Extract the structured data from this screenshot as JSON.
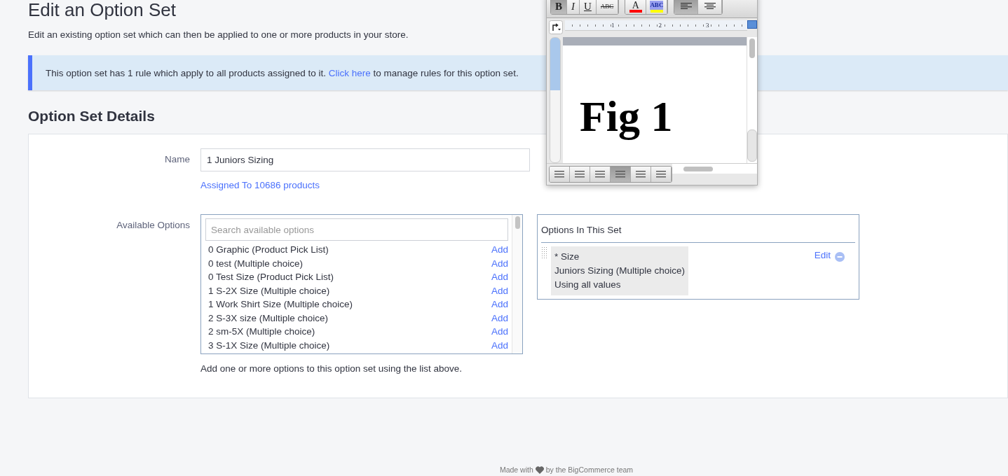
{
  "page": {
    "title": "Edit an Option Set",
    "subtitle": "Edit an existing option set which can then be applied to one or more products in your store."
  },
  "alert": {
    "before": "This option set has 1 rule which apply to all products assigned to it. ",
    "link": "Click here",
    "after": " to manage rules for this option set."
  },
  "section_title": "Option Set Details",
  "name_field": {
    "label": "Name",
    "value": "1 Juniors Sizing",
    "assigned_link": "Assigned To 10686 products"
  },
  "available": {
    "label": "Available Options",
    "placeholder": "Search available options",
    "hint": "Add one or more options to this option set using the list above.",
    "items": [
      {
        "name": "0 Graphic (Product Pick List)",
        "action": "Add"
      },
      {
        "name": "0 test (Multiple choice)",
        "action": "Add"
      },
      {
        "name": "0 Test Size (Product Pick List)",
        "action": "Add"
      },
      {
        "name": "1 S-2X Size (Multiple choice)",
        "action": "Add"
      },
      {
        "name": "1 Work Shirt Size (Multiple choice)",
        "action": "Add"
      },
      {
        "name": "2 S-3X size (Multiple choice)",
        "action": "Add"
      },
      {
        "name": "2 sm-5X (Multiple choice)",
        "action": "Add"
      },
      {
        "name": "3 S-1X Size (Multiple choice)",
        "action": "Add"
      }
    ]
  },
  "in_set": {
    "title": "Options In This Set",
    "items": [
      {
        "lines": [
          "* Size",
          "Juniors Sizing (Multiple choice)",
          "Using all values"
        ],
        "action": "Edit"
      }
    ]
  },
  "editor": {
    "format_buttons": [
      {
        "label": "B",
        "kind": "bold",
        "selected": true
      },
      {
        "label": "I",
        "kind": "italic",
        "selected": false
      },
      {
        "label": "U",
        "kind": "underline",
        "selected": false
      },
      {
        "label": "ABC",
        "kind": "strikethrough",
        "selected": false
      }
    ],
    "font_color": {
      "label": "A",
      "color": "#ff0000"
    },
    "highlight": {
      "label": "ABC",
      "color": "#ffff00"
    },
    "align_buttons": [
      {
        "selected": true
      },
      {
        "selected": false
      }
    ],
    "ruler_labels": [
      "1",
      "2",
      "3"
    ],
    "document_text": "Fig 1",
    "view_buttons": [
      {
        "selected": false
      },
      {
        "selected": false
      },
      {
        "selected": false
      },
      {
        "selected": true
      },
      {
        "selected": false
      },
      {
        "selected": false
      }
    ]
  },
  "footer": {
    "before": "Made with",
    "after": "by the BigCommerce team"
  }
}
